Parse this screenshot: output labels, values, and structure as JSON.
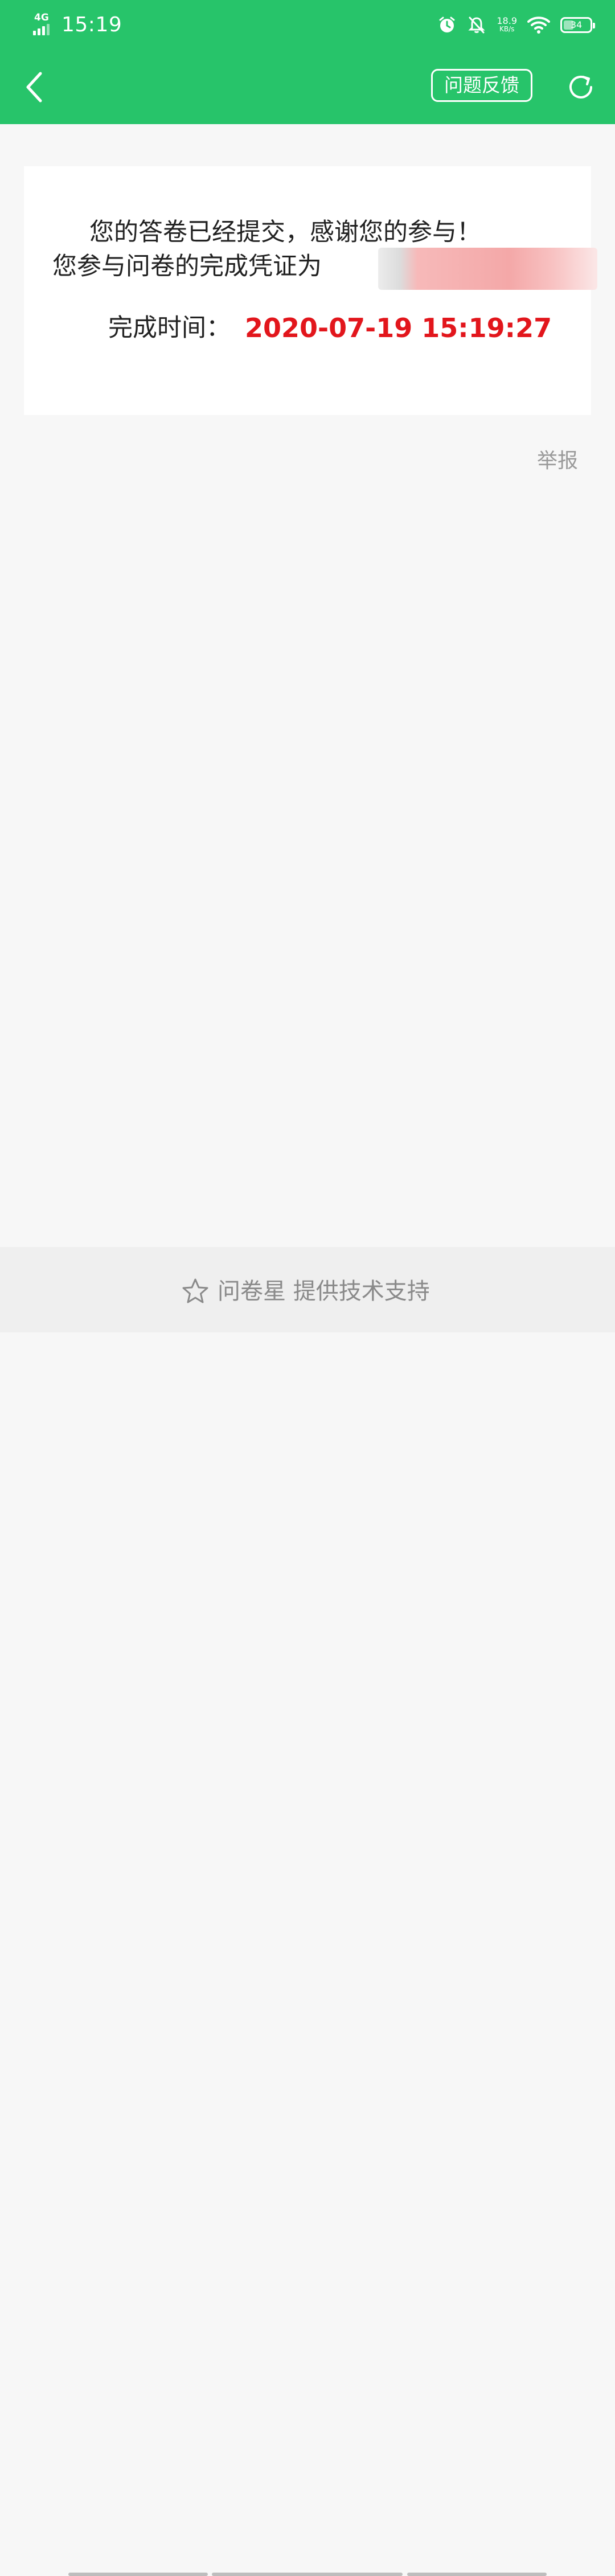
{
  "status_bar": {
    "network": "4G",
    "time": "15:19",
    "speed_value": "18.9",
    "speed_unit": "KB/s",
    "battery": "34",
    "icons": [
      "alarm-icon",
      "bell-muted-icon",
      "wifi-icon",
      "battery-icon"
    ]
  },
  "app_bar": {
    "feedback_label": "问题反馈",
    "icons": [
      "back-arrow-icon",
      "refresh-icon"
    ]
  },
  "result": {
    "line1": "您的答卷已经提交，感谢您的参与！",
    "line2": "您参与问卷的完成凭证为",
    "completion_label": "完成时间：",
    "completion_time": "2020-07-19 15:19:27"
  },
  "report_label": "举报",
  "footer": {
    "text": "问卷星 提供技术支持",
    "icon": "star-outline-icon"
  },
  "colors": {
    "header_green": "#27c46a",
    "time_red": "#e2161c",
    "background": "#f7f7f7"
  }
}
